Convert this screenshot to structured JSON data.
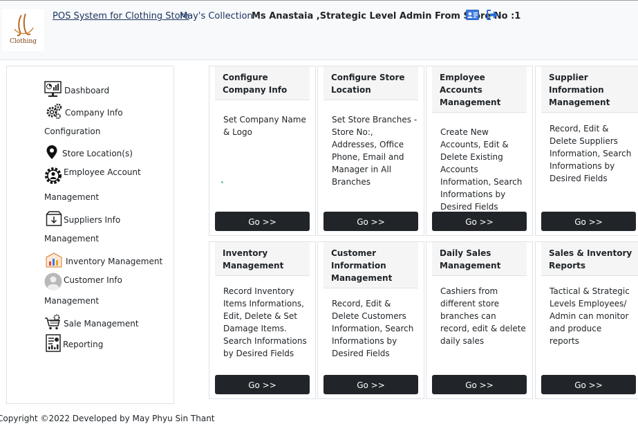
{
  "header": {
    "logo_text": "Clothing",
    "brand": "POS System for Clothing Store",
    "store": "May's Collection",
    "user": "Ms Anastaia ,Strategic Level Admin From Store No :1"
  },
  "sidebar": {
    "items": [
      {
        "label": "Dashboard",
        "icon": "dashboard-icon"
      },
      {
        "label": "Company Info",
        "icon": "gears-icon"
      },
      {
        "label": "Configuration"
      },
      {
        "label": "Store Location(s)",
        "icon": "map-pin-icon"
      },
      {
        "label": "Employee Account",
        "icon": "user-gear-icon"
      },
      {
        "label": "Management"
      },
      {
        "label": "Suppliers Info",
        "icon": "supplier-box-icon"
      },
      {
        "label": "Management"
      },
      {
        "label": "Inventory Management",
        "icon": "inventory-chart-icon"
      },
      {
        "label": "Customer Info",
        "icon": "avatar-icon"
      },
      {
        "label": "Management"
      },
      {
        "label": "Sale Management",
        "icon": "cart-gear-icon"
      },
      {
        "label": "Reporting",
        "icon": "report-icon"
      }
    ]
  },
  "cards": [
    {
      "title": "Configure Company Info",
      "desc": "Set Company Name & Logo",
      "go": "Go >>"
    },
    {
      "title": "Configure Store Location",
      "desc": "Set Store Branches - Store No:, Addresses, Office Phone, Email and Manager in All Branches",
      "go": "Go >>"
    },
    {
      "title": "Employee Accounts Management",
      "desc": "Create New Accounts, Edit & Delete Existing Accounts Information, Search Informations by Desired Fields",
      "go": "Go >>"
    },
    {
      "title": "Supplier Information Management",
      "desc": "Record, Edit & Delete Suppliers Information, Search Informations by Desired Fields",
      "go": "Go >>"
    },
    {
      "title": "Inventory Management",
      "desc": "Record Inventory Items Informations, Edit, Delete & Set Damage Items. Search Informations by Desired Fields",
      "go": "Go >>"
    },
    {
      "title": "Customer Information Management",
      "desc": "Record, Edit & Delete Customers Information, Search Informations by Desired Fields",
      "go": "Go >>"
    },
    {
      "title": "Daily Sales Management",
      "desc": "Cashiers from different store branches can record, edit & delete daily sales",
      "go": "Go >>"
    },
    {
      "title": "Sales & Inventory Reports",
      "desc": "Tactical & Strategic Levels Employees/ Admin can monitor and produce reports",
      "go": "Go >>"
    }
  ],
  "footer": "Copyright ©2022 Developed by May Phyu Sin Thant"
}
